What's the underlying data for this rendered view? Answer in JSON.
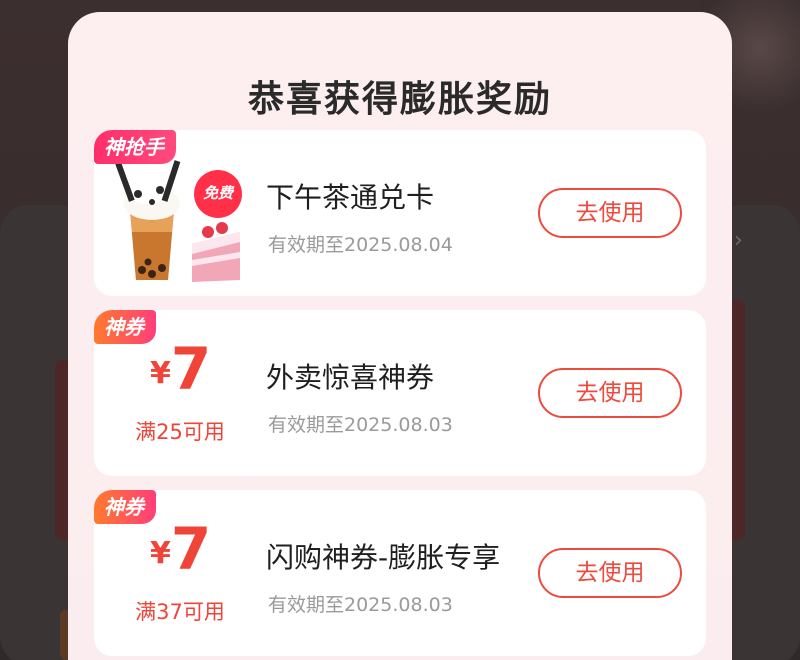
{
  "modal": {
    "title": "恭喜获得膨胀奖励"
  },
  "rewards": [
    {
      "tag": "神抢手",
      "title": "下午茶通兑卡",
      "validity": "有效期至2025.08.04",
      "button": "去使用",
      "badge": "免费"
    },
    {
      "tag": "神券",
      "currency": "¥",
      "amount": "7",
      "condition": "满25可用",
      "title": "外卖惊喜神券",
      "validity": "有效期至2025.08.03",
      "button": "去使用"
    },
    {
      "tag": "神券",
      "currency": "¥",
      "amount": "7",
      "condition": "满37可用",
      "title": "闪购神券-膨胀专享",
      "validity": "有效期至2025.08.03",
      "button": "去使用"
    }
  ],
  "colors": {
    "accent": "#ee4a3e",
    "tag_pink": "#ff2e6a",
    "tag_orange": "#ff7a2e",
    "modal_bg": "#fdeef0"
  }
}
